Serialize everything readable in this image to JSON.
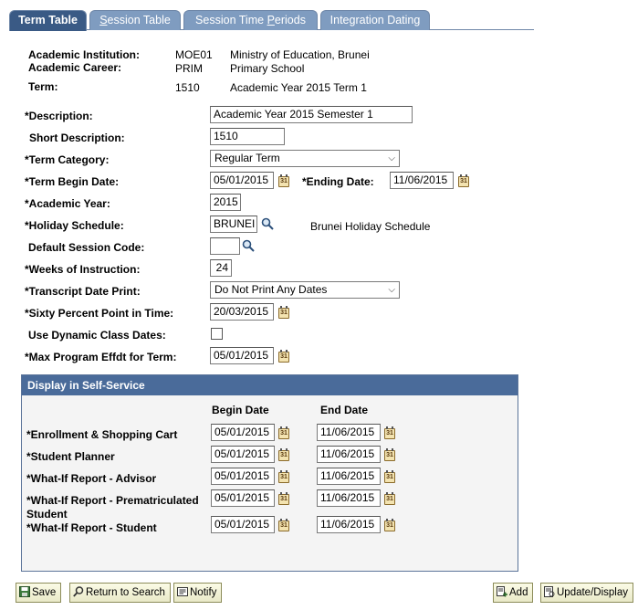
{
  "tabs": [
    {
      "label": "Term Table",
      "active": true
    },
    {
      "label_u": "S",
      "label_rest": "ession Table"
    },
    {
      "label_pre": "Session Time ",
      "label_u": "P",
      "label_rest": "eriods"
    },
    {
      "label": "Integration Dating"
    }
  ],
  "header": {
    "institution_label": "Academic Institution:",
    "institution_code": "MOE01",
    "institution_name": "Ministry of Education, Brunei",
    "career_label": "Academic Career:",
    "career_code": "PRIM",
    "career_name": "Primary School",
    "term_label": "Term:",
    "term_code": "1510",
    "term_name": "Academic Year 2015 Term 1"
  },
  "form": {
    "description_label": "*Description:",
    "description_value": "Academic Year 2015 Semester 1",
    "short_desc_label": "Short Description:",
    "short_desc_value": "1510",
    "term_category_label": "*Term Category:",
    "term_category_value": "Regular Term",
    "begin_date_label": "*Term Begin Date:",
    "begin_date_value": "05/01/2015",
    "ending_date_label": "*Ending Date:",
    "ending_date_value": "11/06/2015",
    "academic_year_label": "*Academic Year:",
    "academic_year_value": "2015",
    "holiday_label": "*Holiday Schedule:",
    "holiday_value": "BRUNEI",
    "holiday_desc": "Brunei Holiday Schedule",
    "default_session_label": "Default Session Code:",
    "default_session_value": "",
    "weeks_label": "*Weeks of Instruction:",
    "weeks_value": "24",
    "transcript_label": "*Transcript Date Print:",
    "transcript_value": "Do Not Print Any Dates",
    "sixty_label": "*Sixty Percent Point in Time:",
    "sixty_value": "20/03/2015",
    "dynamic_label": "Use Dynamic Class Dates:",
    "dynamic_checked": false,
    "max_program_label": "*Max Program Effdt for Term:",
    "max_program_value": "05/01/2015"
  },
  "self_service": {
    "title": "Display in Self-Service",
    "begin_header": "Begin Date",
    "end_header": "End Date",
    "rows": [
      {
        "label": "*Enrollment & Shopping Cart",
        "begin": "05/01/2015",
        "end": "11/06/2015"
      },
      {
        "label": "*Student Planner",
        "begin": "05/01/2015",
        "end": "11/06/2015"
      },
      {
        "label": "*What-If Report - Advisor",
        "begin": "05/01/2015",
        "end": "11/06/2015"
      },
      {
        "label": "*What-If Report - Prematriculated Student",
        "begin": "05/01/2015",
        "end": "11/06/2015"
      },
      {
        "label": "*What-If Report - Student",
        "begin": "05/01/2015",
        "end": "11/06/2015"
      }
    ]
  },
  "buttons": {
    "save": "Save",
    "return_search": "Return to Search",
    "notify": "Notify",
    "add": "Add",
    "update_display": "Update/Display"
  },
  "icons": {
    "calendar": "calendar-icon",
    "lookup": "magnifier-icon"
  }
}
